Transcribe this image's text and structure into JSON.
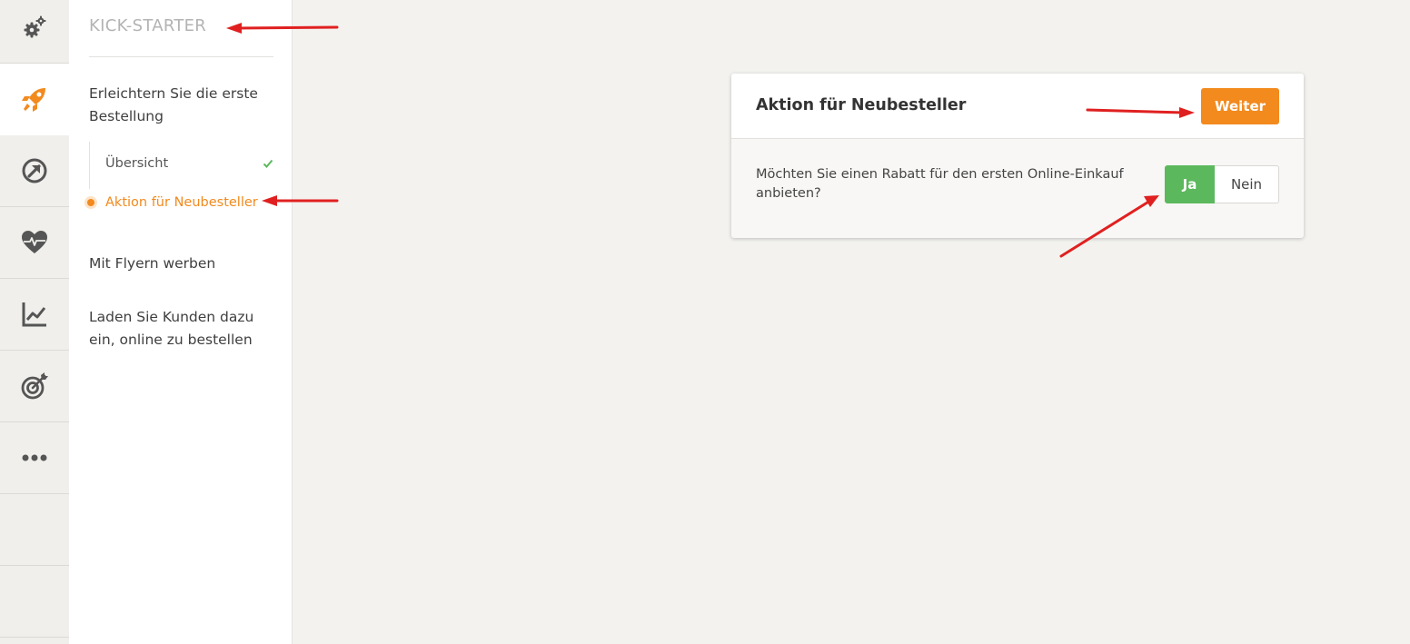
{
  "rail": {
    "items": [
      {
        "icon": "gears-icon",
        "active": false
      },
      {
        "icon": "rocket-icon",
        "active": true
      },
      {
        "icon": "arrow-circle-icon",
        "active": false
      },
      {
        "icon": "heart-pulse-icon",
        "active": false
      },
      {
        "icon": "line-chart-icon",
        "active": false
      },
      {
        "icon": "target-icon",
        "active": false
      },
      {
        "icon": "more-dots-icon",
        "active": false
      }
    ]
  },
  "sidebar": {
    "title": "KICK-STARTER",
    "section1": "Erleichtern Sie die erste Bestellung",
    "sub_items": [
      {
        "label": "Übersicht",
        "status": "done"
      },
      {
        "label": "Aktion für Neubesteller",
        "status": "current"
      }
    ],
    "section2": "Mit Flyern werben",
    "section3": "Laden Sie Kunden dazu ein, online zu bestellen"
  },
  "card": {
    "title": "Aktion für Neubesteller",
    "next_button": "Weiter",
    "question": "Möchten Sie einen Rabatt für den ersten Online-Einkauf anbieten?",
    "yes_label": "Ja",
    "no_label": "Nein",
    "selected": "Ja"
  },
  "colors": {
    "accent": "#f28a1e",
    "success": "#5cb85c",
    "annotation": "#e02020"
  }
}
